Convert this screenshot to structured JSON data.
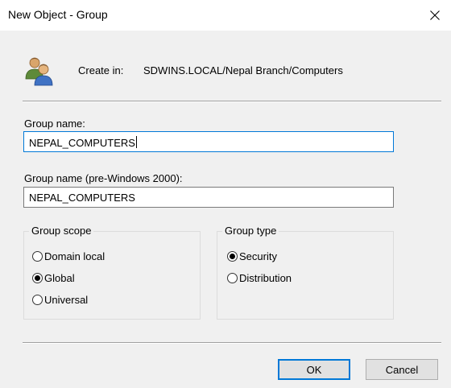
{
  "window": {
    "title": "New Object - Group"
  },
  "header": {
    "create_in_label": "Create in:",
    "create_in_path": "SDWINS.LOCAL/Nepal Branch/Computers"
  },
  "form": {
    "group_name_label": "Group name:",
    "group_name_value": "NEPAL_COMPUTERS",
    "pre2000_label": "Group name (pre-Windows 2000):",
    "pre2000_value": "NEPAL_COMPUTERS"
  },
  "scope": {
    "title": "Group scope",
    "options": [
      "Domain local",
      "Global",
      "Universal"
    ],
    "selected": "Global"
  },
  "type": {
    "title": "Group type",
    "options": [
      "Security",
      "Distribution"
    ],
    "selected": "Security"
  },
  "buttons": {
    "ok": "OK",
    "cancel": "Cancel"
  },
  "icons": {
    "title_close": "close-icon",
    "object": "group-users-icon"
  },
  "colors": {
    "focus_border": "#0078d7",
    "dialog_bg": "#f0f0f0"
  }
}
